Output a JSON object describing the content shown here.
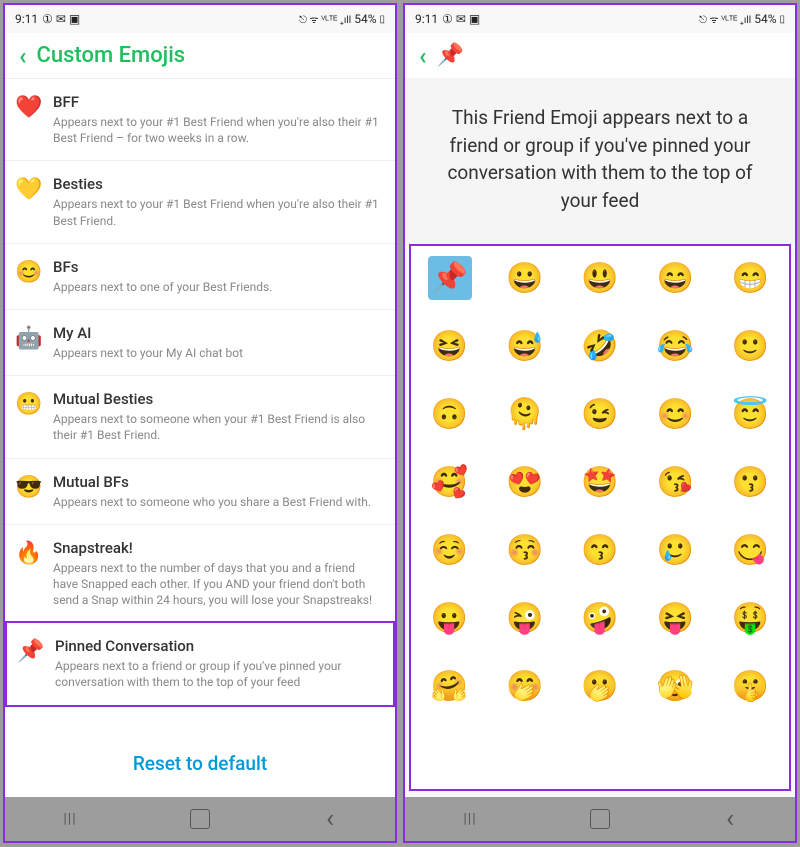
{
  "status": {
    "time": "9:11",
    "left_icons": "① ✉ ▣",
    "right_icons": "⎋ ᯤ ⱽᴸᵀᴱ ₊ıll",
    "battery": "54%",
    "battery_icon": "▯"
  },
  "left": {
    "back": "‹",
    "title": "Custom Emojis",
    "reset": "Reset to default",
    "items": [
      {
        "emoji": "❤️",
        "title": "BFF",
        "desc": "Appears next to your #1 Best Friend when you're also their #1 Best Friend – for two weeks in a row."
      },
      {
        "emoji": "💛",
        "title": "Besties",
        "desc": "Appears next to your #1 Best Friend when you're also their #1 Best Friend."
      },
      {
        "emoji": "😊",
        "title": "BFs",
        "desc": "Appears next to one of your Best Friends."
      },
      {
        "emoji": "🤖",
        "title": "My AI",
        "desc": "Appears next to your My AI chat bot"
      },
      {
        "emoji": "😬",
        "title": "Mutual Besties",
        "desc": "Appears next to someone when your #1 Best Friend is also their #1 Best Friend."
      },
      {
        "emoji": "😎",
        "title": "Mutual BFs",
        "desc": "Appears next to someone who you share a Best Friend with."
      },
      {
        "emoji": "🔥",
        "title": "Snapstreak!",
        "desc": "Appears next to the number of days that you and a friend have Snapped each other. If you AND your friend don't both send a Snap within 24 hours, you will lose your Snapstreaks!"
      },
      {
        "emoji": "📌",
        "title": "Pinned Conversation",
        "desc": "Appears next to a friend or group if you've pinned your conversation with them to the top of your feed",
        "highlight": true
      }
    ]
  },
  "right": {
    "back": "‹",
    "current_emoji": "📌",
    "instruction": "This Friend Emoji appears next to a friend or group if you've pinned your conversation with them to the top of your feed",
    "grid": [
      [
        "📌",
        "😀",
        "😃",
        "😄",
        "😁"
      ],
      [
        "😆",
        "😅",
        "🤣",
        "😂",
        "🙂"
      ],
      [
        "🙃",
        "🫠",
        "😉",
        "😊",
        "😇"
      ],
      [
        "🥰",
        "😍",
        "🤩",
        "😘",
        "😗"
      ],
      [
        "☺️",
        "😚",
        "😙",
        "🥲",
        "😋"
      ],
      [
        "😛",
        "😜",
        "🤪",
        "😝",
        "🤑"
      ],
      [
        "🤗",
        "🤭",
        "🫢",
        "🫣",
        "🤫"
      ]
    ],
    "selected": 0
  }
}
